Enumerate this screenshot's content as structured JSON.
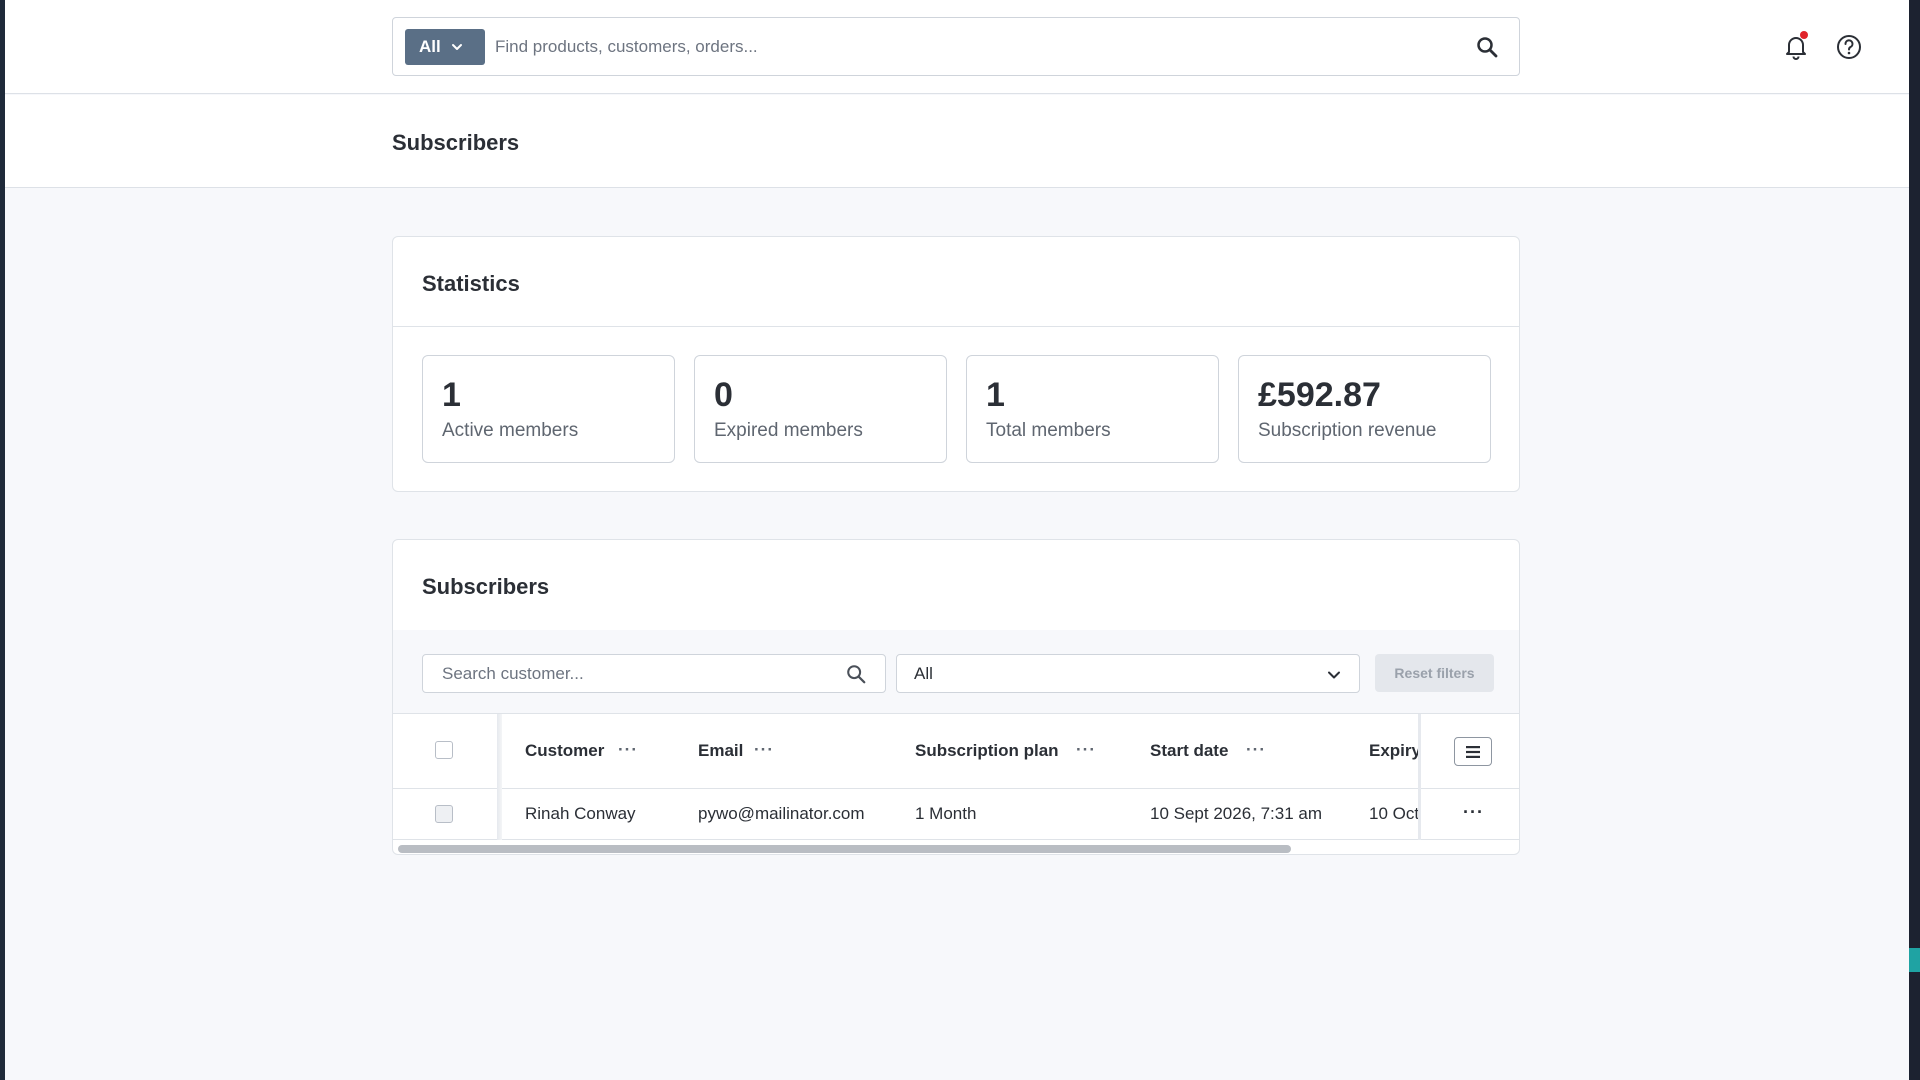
{
  "search": {
    "scope_label": "All",
    "placeholder": "Find products, customers, orders...",
    "value": ""
  },
  "icons": {
    "search": "search-icon",
    "scope_chevron": "chevron-down-icon",
    "notifications": "bell-icon",
    "help": "help-circle-icon",
    "column_menu": "menu-lines-icon"
  },
  "colors": {
    "scope_button": "#5a6f86",
    "notification_dot": "#e0242b",
    "page_bg": "#f7f8fb"
  },
  "page": {
    "title": "Subscribers"
  },
  "statistics": {
    "title": "Statistics",
    "items": [
      {
        "value": "1",
        "label": "Active members"
      },
      {
        "value": "0",
        "label": "Expired members"
      },
      {
        "value": "1",
        "label": "Total members"
      },
      {
        "value": "£592.87",
        "label": "Subscription revenue"
      }
    ]
  },
  "subscribers": {
    "title": "Subscribers",
    "search_placeholder": "Search customer...",
    "status_filter": "All",
    "reset_label": "Reset filters",
    "columns": [
      "Customer",
      "Email",
      "Subscription plan",
      "Start date",
      "Expiry"
    ],
    "rows": [
      {
        "customer": "Rinah Conway",
        "email": "pywo@mailinator.com",
        "plan": "1 Month",
        "start": "10 Sept 2026, 7:31 am",
        "expiry": "10 Oct"
      }
    ]
  }
}
